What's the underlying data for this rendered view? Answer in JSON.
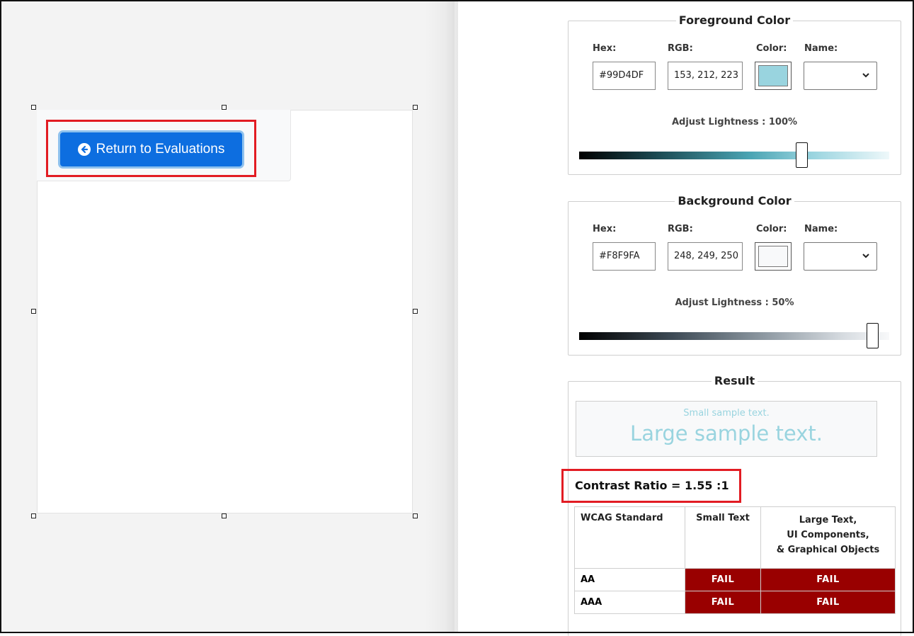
{
  "left": {
    "return_button_label": "Return to Evaluations"
  },
  "foreground": {
    "title": "Foreground Color",
    "hex_label": "Hex:",
    "rgb_label": "RGB:",
    "color_label": "Color:",
    "name_label": "Name:",
    "hex_value": "#99D4DF",
    "rgb_value": "153, 212, 223",
    "swatch_color": "#99D4DF",
    "adjust_label": "Adjust Lightness : 100%",
    "lightness_percent": 100
  },
  "background": {
    "title": "Background Color",
    "hex_label": "Hex:",
    "rgb_label": "RGB:",
    "color_label": "Color:",
    "name_label": "Name:",
    "hex_value": "#F8F9FA",
    "rgb_value": "248, 249, 250",
    "swatch_color": "#F8F9FA",
    "adjust_label": "Adjust Lightness : 50%",
    "lightness_percent": 50
  },
  "result": {
    "title": "Result",
    "small_sample": "Small sample text.",
    "large_sample": "Large sample text.",
    "contrast_ratio": "Contrast Ratio = 1.55 :1",
    "table": {
      "headers": [
        "WCAG Standard",
        "Small Text",
        "Large Text,",
        "UI Components,",
        "& Graphical Objects"
      ],
      "rows": [
        {
          "standard": "AA",
          "small": "FAIL",
          "large": "FAIL"
        },
        {
          "standard": "AAA",
          "small": "FAIL",
          "large": "FAIL"
        }
      ]
    }
  },
  "colors": {
    "accent_blue": "#0D6EE0",
    "fail_red": "#990000",
    "highlight_red": "#E21C23"
  }
}
